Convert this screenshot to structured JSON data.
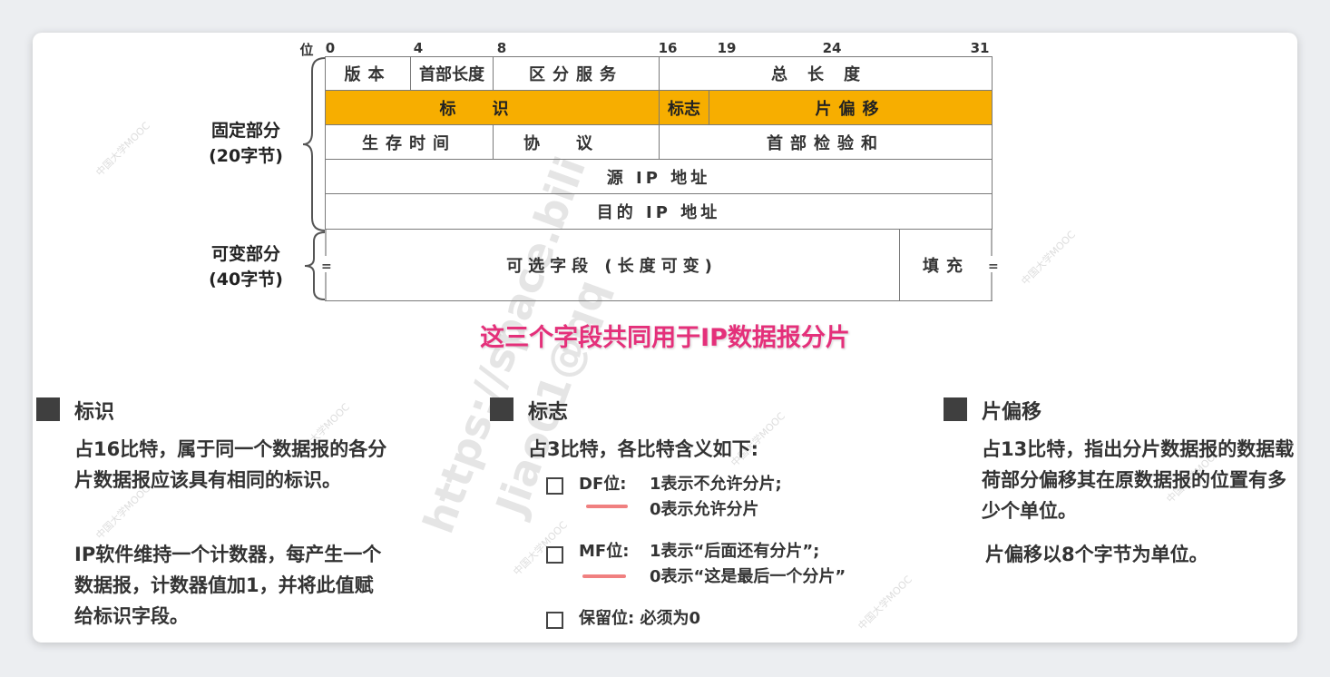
{
  "header": {
    "bit_axis_label": "位",
    "bit_ticks": [
      "0",
      "4",
      "8",
      "16",
      "19",
      "24",
      "31"
    ]
  },
  "groups": {
    "fixed": {
      "line1": "固定部分",
      "line2": "(20字节)"
    },
    "variable": {
      "line1": "可变部分",
      "line2": "(40字节)"
    }
  },
  "fields": {
    "version": "版本",
    "ihl": "首部长度",
    "dsf": "区分服务",
    "total_length": "总长度",
    "identification": "标识",
    "flags": "标志",
    "fragment_offset": "片偏移",
    "ttl": "生存时间",
    "protocol": "协议",
    "checksum": "首部检验和",
    "src_ip": "源 IP 地址",
    "dst_ip": "目的 IP 地址",
    "options": "可选字段 (长度可变)",
    "padding": "填充",
    "edge_left": "=",
    "edge_right": "="
  },
  "highlight_color": "#f7ae00",
  "callout": "这三个字段共同用于IP数据报分片",
  "callout_color": "#e4307a",
  "sections": {
    "identification": {
      "title": "标识",
      "para1": "占16比特，属于同一个数据报的各分片数据报应该具有相同的标识。",
      "para2": "IP软件维持一个计数器，每产生一个数据报，计数器值加1，并将此值赋给标识字段。"
    },
    "flags": {
      "title": "标志",
      "intro": "占3比特，各比特含义如下:",
      "df_label": "DF位:",
      "df_1": "1表示不允许分片;",
      "df_0": "0表示允许分片",
      "mf_label": "MF位:",
      "mf_1": "1表示“后面还有分片”;",
      "mf_0": "0表示“这是最后一个分片”",
      "reserved": "保留位: 必须为0"
    },
    "fragment_offset": {
      "title": "片偏移",
      "para1": "占13比特，指出分片数据报的数据载荷部分偏移其在原数据报的位置有多少个单位。",
      "para2": "片偏移以8个字节为单位。"
    }
  },
  "watermarks": {
    "small": "中国大学MOOC",
    "big1": "https://space.bili",
    "big2": "Jiao01@qq"
  }
}
